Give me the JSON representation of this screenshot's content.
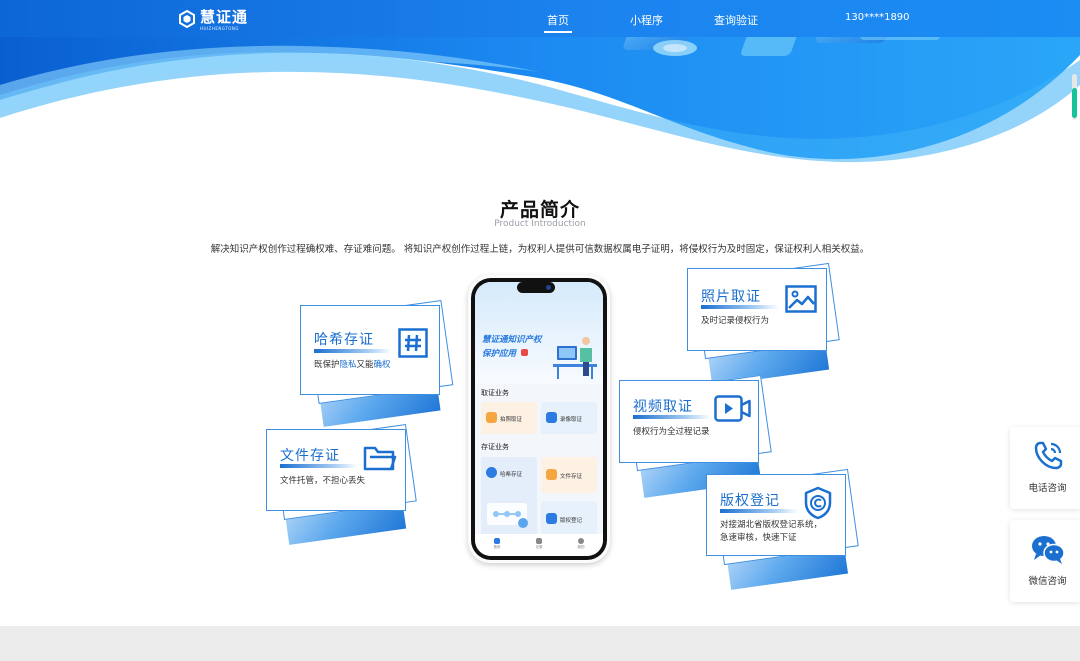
{
  "brand": {
    "name": "慧证通",
    "sub": "HUIZHENGTONG"
  },
  "nav": {
    "items": [
      {
        "label": "首页",
        "active": true
      },
      {
        "label": "小程序",
        "active": false
      },
      {
        "label": "查询验证",
        "active": false
      }
    ],
    "phone": "130****1890"
  },
  "intro": {
    "title": "产品简介",
    "subtitle": "Product Introduction",
    "description": "解决知识产权创作过程确权难、存证难问题。 将知识产权创作过程上链，为权利人提供可信数据权属电子证明，将侵权行为及时固定，保证权利人相关权益。"
  },
  "cards": {
    "hash": {
      "title": "哈希存证",
      "desc_a": "既保护",
      "desc_b": "隐私",
      "desc_c": "又能",
      "desc_d": "确权",
      "icon": "hash-icon"
    },
    "file": {
      "title": "文件存证",
      "desc": "文件托管，不担心丢失",
      "icon": "folder-icon"
    },
    "photo": {
      "title": "照片取证",
      "desc": "及时记录侵权行为",
      "icon": "image-icon"
    },
    "video": {
      "title": "视频取证",
      "desc": "侵权行为全过程记录",
      "icon": "video-icon"
    },
    "copyright": {
      "title": "版权登记",
      "desc_1": "对接湖北省版权登记系统，",
      "desc_2": "急速审核，快速下证",
      "icon": "copyright-shield-icon"
    }
  },
  "phone_screen": {
    "hero_line1": "慧证通知识产权",
    "hero_line2": "保护应用",
    "section1": "取证业务",
    "section2": "存证业务",
    "tiles": {
      "photo": "拍照取证",
      "video": "录像取证",
      "hash": "哈希存证",
      "file": "文件存证",
      "copyright": "版权登记"
    },
    "tabs": [
      "首页",
      "记录",
      "我的"
    ]
  },
  "side": {
    "phone_consult": "电话咨询",
    "wechat_consult": "微信咨询"
  },
  "colors": {
    "primary": "#1b6fcf",
    "nav_bg": "#1c83ef",
    "accent_green": "#14c49b"
  }
}
